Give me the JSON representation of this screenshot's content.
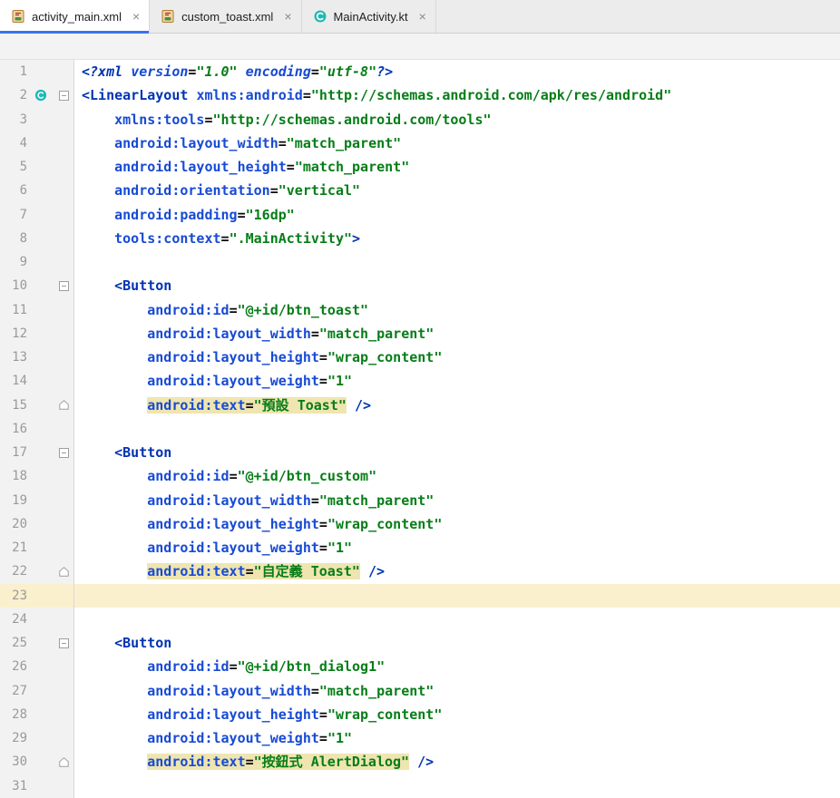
{
  "tabs": [
    {
      "label": "activity_main.xml",
      "icon": "android-xml-file-icon",
      "close": "×",
      "active": true
    },
    {
      "label": "custom_toast.xml",
      "icon": "android-xml-file-icon",
      "close": "×",
      "active": false
    },
    {
      "label": "MainActivity.kt",
      "icon": "kotlin-class-icon",
      "close": "×",
      "active": false
    }
  ],
  "colors": {
    "accent": "#3574F0",
    "tag": "#0033B3",
    "attribute": "#174AD4",
    "value": "#067D17",
    "plain": "#080808",
    "caret_line_bg": "#FAF0CE",
    "warning_bg": "#EFE5B0",
    "gutter_bg": "#F2F2F2",
    "line_number": "#9A9A9A",
    "class_icon": "#1FB9B4"
  },
  "editor": {
    "caret_line": 23,
    "lines": [
      {
        "num": 1,
        "seg": [
          [
            "k i",
            "<?xml "
          ],
          [
            "a i",
            "version"
          ],
          [
            "p i",
            "="
          ],
          [
            "v i",
            "\"1.0\""
          ],
          [
            "p i",
            " "
          ],
          [
            "a i",
            "encoding"
          ],
          [
            "p i",
            "="
          ],
          [
            "v i",
            "\"utf-8\""
          ],
          [
            "k i",
            "?>"
          ]
        ]
      },
      {
        "num": 2,
        "class_icon": true,
        "fold": "start",
        "seg": [
          [
            "k",
            "<LinearLayout "
          ],
          [
            "a",
            "xmlns:android"
          ],
          [
            "p",
            "="
          ],
          [
            "v",
            "\"http://schemas.android.com/apk/res/android\""
          ]
        ]
      },
      {
        "num": 3,
        "seg": [
          [
            "p",
            "    "
          ],
          [
            "a",
            "xmlns:tools"
          ],
          [
            "p",
            "="
          ],
          [
            "v",
            "\"http://schemas.android.com/tools\""
          ]
        ]
      },
      {
        "num": 4,
        "seg": [
          [
            "p",
            "    "
          ],
          [
            "a",
            "android:layout_width"
          ],
          [
            "p",
            "="
          ],
          [
            "v",
            "\"match_parent\""
          ]
        ]
      },
      {
        "num": 5,
        "seg": [
          [
            "p",
            "    "
          ],
          [
            "a",
            "android:layout_height"
          ],
          [
            "p",
            "="
          ],
          [
            "v",
            "\"match_parent\""
          ]
        ]
      },
      {
        "num": 6,
        "seg": [
          [
            "p",
            "    "
          ],
          [
            "a",
            "android:orientation"
          ],
          [
            "p",
            "="
          ],
          [
            "v",
            "\"vertical\""
          ]
        ]
      },
      {
        "num": 7,
        "seg": [
          [
            "p",
            "    "
          ],
          [
            "a",
            "android:padding"
          ],
          [
            "p",
            "="
          ],
          [
            "v",
            "\"16dp\""
          ]
        ]
      },
      {
        "num": 8,
        "seg": [
          [
            "p",
            "    "
          ],
          [
            "a",
            "tools:context"
          ],
          [
            "p",
            "="
          ],
          [
            "v",
            "\".MainActivity\""
          ],
          [
            "k",
            ">"
          ]
        ]
      },
      {
        "num": 9,
        "seg": []
      },
      {
        "num": 10,
        "fold": "start",
        "seg": [
          [
            "p",
            "    "
          ],
          [
            "k",
            "<Button"
          ]
        ]
      },
      {
        "num": 11,
        "seg": [
          [
            "p",
            "        "
          ],
          [
            "a",
            "android:id"
          ],
          [
            "p",
            "="
          ],
          [
            "v",
            "\"@+id/btn_toast\""
          ]
        ]
      },
      {
        "num": 12,
        "seg": [
          [
            "p",
            "        "
          ],
          [
            "a",
            "android:layout_width"
          ],
          [
            "p",
            "="
          ],
          [
            "v",
            "\"match_parent\""
          ]
        ]
      },
      {
        "num": 13,
        "seg": [
          [
            "p",
            "        "
          ],
          [
            "a",
            "android:layout_height"
          ],
          [
            "p",
            "="
          ],
          [
            "v",
            "\"wrap_content\""
          ]
        ]
      },
      {
        "num": 14,
        "seg": [
          [
            "p",
            "        "
          ],
          [
            "a",
            "android:layout_weight"
          ],
          [
            "p",
            "="
          ],
          [
            "v",
            "\"1\""
          ]
        ]
      },
      {
        "num": 15,
        "fold": "end",
        "seg": [
          [
            "p",
            "        "
          ],
          [
            "a w",
            "android:text"
          ],
          [
            "p w",
            "="
          ],
          [
            "v w",
            "\"預設 Toast\""
          ],
          [
            "p",
            " "
          ],
          [
            "k",
            "/>"
          ]
        ]
      },
      {
        "num": 16,
        "seg": []
      },
      {
        "num": 17,
        "fold": "start",
        "seg": [
          [
            "p",
            "    "
          ],
          [
            "k",
            "<Button"
          ]
        ]
      },
      {
        "num": 18,
        "seg": [
          [
            "p",
            "        "
          ],
          [
            "a",
            "android:id"
          ],
          [
            "p",
            "="
          ],
          [
            "v",
            "\"@+id/btn_custom\""
          ]
        ]
      },
      {
        "num": 19,
        "seg": [
          [
            "p",
            "        "
          ],
          [
            "a",
            "android:layout_width"
          ],
          [
            "p",
            "="
          ],
          [
            "v",
            "\"match_parent\""
          ]
        ]
      },
      {
        "num": 20,
        "seg": [
          [
            "p",
            "        "
          ],
          [
            "a",
            "android:layout_height"
          ],
          [
            "p",
            "="
          ],
          [
            "v",
            "\"wrap_content\""
          ]
        ]
      },
      {
        "num": 21,
        "seg": [
          [
            "p",
            "        "
          ],
          [
            "a",
            "android:layout_weight"
          ],
          [
            "p",
            "="
          ],
          [
            "v",
            "\"1\""
          ]
        ]
      },
      {
        "num": 22,
        "fold": "end",
        "seg": [
          [
            "p",
            "        "
          ],
          [
            "a w",
            "android:text"
          ],
          [
            "p w",
            "="
          ],
          [
            "v w",
            "\"自定義 Toast\""
          ],
          [
            "p",
            " "
          ],
          [
            "k",
            "/>"
          ]
        ]
      },
      {
        "num": 23,
        "seg": []
      },
      {
        "num": 24,
        "seg": []
      },
      {
        "num": 25,
        "fold": "start",
        "seg": [
          [
            "p",
            "    "
          ],
          [
            "k",
            "<Button"
          ]
        ]
      },
      {
        "num": 26,
        "seg": [
          [
            "p",
            "        "
          ],
          [
            "a",
            "android:id"
          ],
          [
            "p",
            "="
          ],
          [
            "v",
            "\"@+id/btn_dialog1\""
          ]
        ]
      },
      {
        "num": 27,
        "seg": [
          [
            "p",
            "        "
          ],
          [
            "a",
            "android:layout_width"
          ],
          [
            "p",
            "="
          ],
          [
            "v",
            "\"match_parent\""
          ]
        ]
      },
      {
        "num": 28,
        "seg": [
          [
            "p",
            "        "
          ],
          [
            "a",
            "android:layout_height"
          ],
          [
            "p",
            "="
          ],
          [
            "v",
            "\"wrap_content\""
          ]
        ]
      },
      {
        "num": 29,
        "seg": [
          [
            "p",
            "        "
          ],
          [
            "a",
            "android:layout_weight"
          ],
          [
            "p",
            "="
          ],
          [
            "v",
            "\"1\""
          ]
        ]
      },
      {
        "num": 30,
        "fold": "end",
        "seg": [
          [
            "p",
            "        "
          ],
          [
            "a w",
            "android:text"
          ],
          [
            "p w",
            "="
          ],
          [
            "v w",
            "\"按鈕式 AlertDialog\""
          ],
          [
            "p",
            " "
          ],
          [
            "k",
            "/>"
          ]
        ]
      },
      {
        "num": 31,
        "seg": []
      }
    ]
  }
}
